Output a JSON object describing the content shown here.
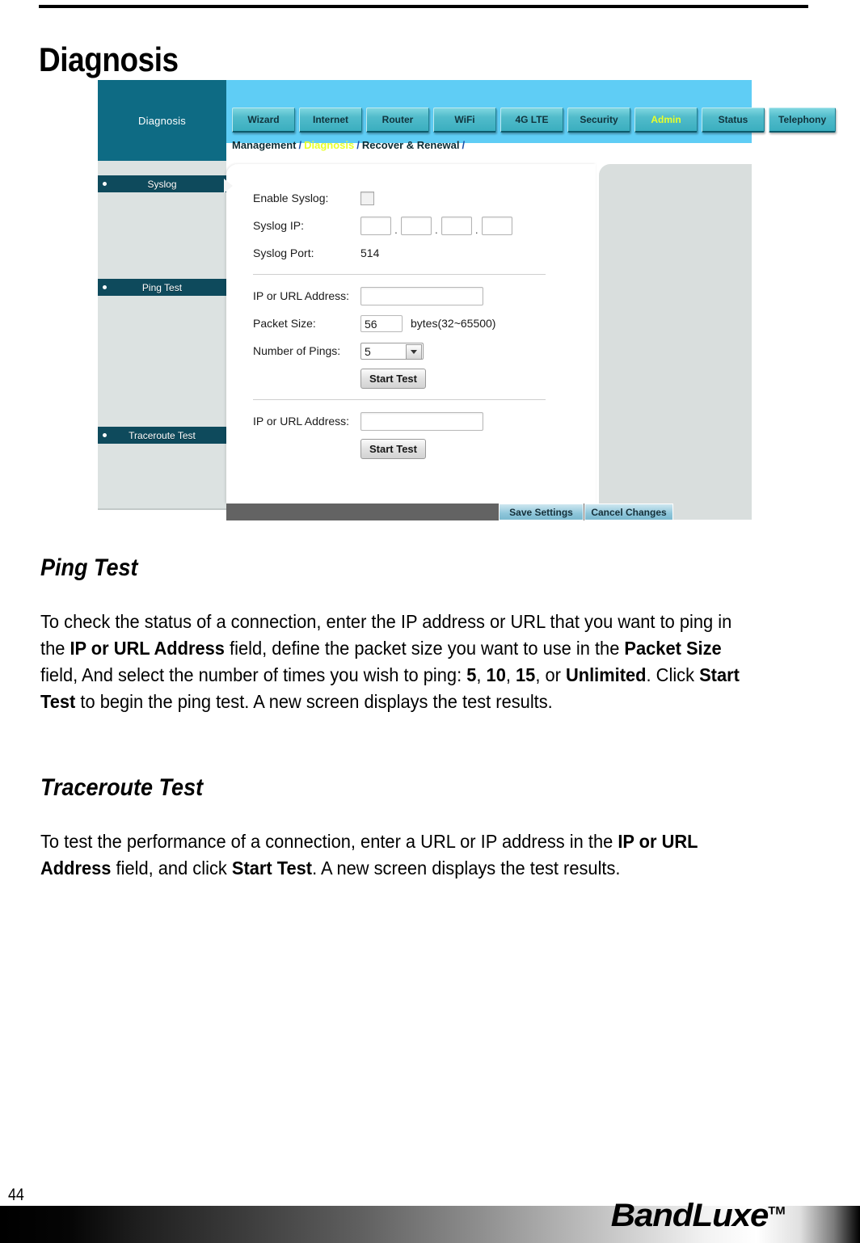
{
  "page": {
    "title": "Diagnosis",
    "number": "44",
    "footer_logo": "BandLuxe",
    "footer_logo_tm": "TM"
  },
  "screenshot": {
    "brand_label": "Diagnosis",
    "tabs": [
      {
        "label": "Wizard",
        "active": false
      },
      {
        "label": "Internet",
        "active": false
      },
      {
        "label": "Router",
        "active": false
      },
      {
        "label": "WiFi",
        "active": false
      },
      {
        "label": "4G LTE",
        "active": false
      },
      {
        "label": "Security",
        "active": false
      },
      {
        "label": "Admin",
        "active": true
      },
      {
        "label": "Status",
        "active": false
      },
      {
        "label": "Telephony",
        "active": false
      }
    ],
    "breadcrumb": {
      "item1": "Management",
      "item2": "Diagnosis",
      "item3": "Recover & Renewal",
      "separator": "/"
    },
    "sidebar": [
      {
        "label": "Syslog"
      },
      {
        "label": "Ping Test"
      },
      {
        "label": "Traceroute Test"
      }
    ],
    "form": {
      "enable_syslog_label": "Enable Syslog:",
      "enable_syslog_checked": false,
      "syslog_ip_label": "Syslog IP:",
      "syslog_ip_octets": [
        "",
        "",
        "",
        ""
      ],
      "syslog_ip_dot": ".",
      "syslog_port_label": "Syslog Port:",
      "syslog_port_value": "514",
      "ping_ip_label": "IP or URL Address:",
      "ping_ip_value": "",
      "packet_size_label": "Packet Size:",
      "packet_size_value": "56",
      "packet_size_unit": "bytes(32~65500)",
      "number_of_pings_label": "Number of Pings:",
      "number_of_pings_value": "5",
      "number_of_pings_options": [
        "5",
        "10",
        "15",
        "Unlimited"
      ],
      "ping_start_label": "Start Test",
      "trace_ip_label": "IP or URL Address:",
      "trace_ip_value": "",
      "trace_start_label": "Start Test"
    },
    "actions": {
      "save_label": "Save Settings",
      "cancel_label": "Cancel Changes"
    }
  },
  "sections": [
    {
      "heading": "Ping Test",
      "body_parts": [
        {
          "t": "To check the status of a connection, enter the IP address or URL that you want to ping in the ",
          "b": false
        },
        {
          "t": "IP or URL Address",
          "b": true
        },
        {
          "t": " field, define the packet size you want to use in the ",
          "b": false
        },
        {
          "t": "Packet Size",
          "b": true
        },
        {
          "t": " field, And select the number of times you wish to ping: ",
          "b": false
        },
        {
          "t": "5",
          "b": true
        },
        {
          "t": ", ",
          "b": false
        },
        {
          "t": "10",
          "b": true
        },
        {
          "t": ", ",
          "b": false
        },
        {
          "t": "15",
          "b": true
        },
        {
          "t": ", or ",
          "b": false
        },
        {
          "t": "Unlimited",
          "b": true
        },
        {
          "t": ". Click ",
          "b": false
        },
        {
          "t": "Start Test",
          "b": true
        },
        {
          "t": " to begin the ping test. A new screen displays the test results.",
          "b": false
        }
      ]
    },
    {
      "heading": "Traceroute Test",
      "body_parts": [
        {
          "t": "To test the performance of a connection, enter a URL or IP address in the ",
          "b": false
        },
        {
          "t": "IP or URL Address",
          "b": true
        },
        {
          "t": " field, and click ",
          "b": false
        },
        {
          "t": "Start Test",
          "b": true
        },
        {
          "t": ". A new screen displays the test results.",
          "b": false
        }
      ]
    }
  ],
  "colors": {
    "header_blue": "#5fcdf5",
    "brand_teal": "#0e6b84",
    "tab_teal": "#3aaebf",
    "active_tab_text": "#e8ff2a",
    "sidebar_bg": "#dce2e1",
    "sidebar_item": "#0e4a5c"
  }
}
